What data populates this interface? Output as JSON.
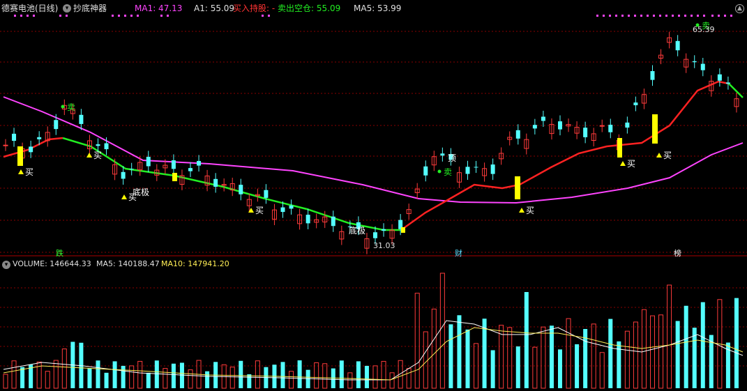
{
  "header": {
    "stock_name": "德赛电池(日线)",
    "indicator_name": "抄底神器",
    "ma1_label": "MA1: 47.13",
    "a1_label": "A1: 55.09",
    "buy_hold_label": "买入持股: -",
    "sell_flat_label": "卖出空仓: 55.09",
    "ma5_label": "MA5: 53.99"
  },
  "volume_header": {
    "volume_label": "VOLUME: 146644.33",
    "ma5_label": "MA5: 140188.47",
    "ma10_label": "MA10: 147941.20"
  },
  "markers": {
    "high_price": "65.39",
    "low_price": "31.03",
    "buy": "买",
    "sell": "卖",
    "top": "顶",
    "bottom_ji": "底极",
    "event_die": "跌",
    "event_cai": "财",
    "event_bang": "榜"
  },
  "colors": {
    "up": "#ff3b3b",
    "down": "#54ffff",
    "ma_purple": "#ff44ff",
    "trend_green": "#22ee22",
    "trend_red": "#ff2222",
    "signal_yellow": "#ffff00",
    "grid": "#8b0000"
  },
  "chart_data": {
    "type": "candlestick",
    "price_range": [
      30,
      68
    ],
    "price_scale": "unlabeled",
    "candle_count": 88,
    "volume_range": "unlabeled"
  }
}
